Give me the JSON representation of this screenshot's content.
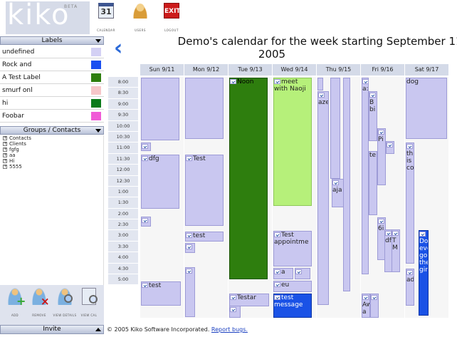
{
  "app": {
    "logo_text": "kiko",
    "logo_badge": "BETA",
    "toolbar": [
      {
        "label": "CALENDAR",
        "glyph": "31",
        "icon": "calendar-icon"
      },
      {
        "label": "USERS",
        "glyph": "",
        "icon": "users-icon"
      },
      {
        "label": "LOGOUT",
        "glyph": "EXIT",
        "icon": "exit-icon"
      }
    ]
  },
  "labels_panel": {
    "header": "Labels",
    "items": [
      {
        "name": "undefined",
        "color": "#d3d0f4"
      },
      {
        "name": "Rock and",
        "color": "#1a4ff0"
      },
      {
        "name": "A Test Label",
        "color": "#2e7e0e"
      },
      {
        "name": "smurf onl",
        "color": "#f6c6c9"
      },
      {
        "name": "hi",
        "color": "#0a7a1a"
      },
      {
        "name": "Foobar",
        "color": "#f05ad7"
      }
    ]
  },
  "groups_panel": {
    "header": "Groups / Contacts",
    "items": [
      "Contacts",
      "Clients",
      "fgfg",
      "aa",
      "Hi",
      "5555"
    ]
  },
  "group_actions": [
    {
      "label": "ADD",
      "icon": "add-user-icon"
    },
    {
      "label": "REMOVE",
      "icon": "remove-user-icon"
    },
    {
      "label": "VIEW DETAILS",
      "icon": "view-details-icon"
    },
    {
      "label": "VIEW CAL",
      "icon": "view-cal-icon"
    }
  ],
  "invite": {
    "label": "Invite"
  },
  "calendar": {
    "title_line1": "Demo's calendar for the week starting September 11,",
    "title_line2": "2005",
    "days": [
      "Sun 9/11",
      "Mon 9/12",
      "Tue 9/13",
      "Wed 9/14",
      "Thu 9/15",
      "Fri 9/16",
      "Sat 9/17"
    ],
    "times": [
      "8:00",
      "8:30",
      "9:00",
      "9:30",
      "10:00",
      "10:30",
      "11:00",
      "11:30",
      "12:00",
      "12:30",
      "1:00",
      "1:30",
      "2:00",
      "2:30",
      "3:00",
      "3:30",
      "4:00",
      "4:30",
      "5:00"
    ],
    "events": [
      {
        "title": "Noon"
      },
      {
        "title": "meet with Naoji"
      },
      {
        "title": "aze"
      },
      {
        "title": "a:"
      },
      {
        "title": "B"
      },
      {
        "title": "bi"
      },
      {
        "title": "dog"
      },
      {
        "title": "dfg"
      },
      {
        "title": "Test"
      },
      {
        "title": "Pi"
      },
      {
        "title": "te"
      },
      {
        "title": "this is coc"
      },
      {
        "title": "aja"
      },
      {
        "title": "test"
      },
      {
        "title": "Test appointme"
      },
      {
        "title": "6i"
      },
      {
        "title": "df"
      },
      {
        "title": "T M"
      },
      {
        "title": "Do eve go the gir"
      },
      {
        "title": "a"
      },
      {
        "title": "test"
      },
      {
        "title": "eu"
      },
      {
        "title": "ads"
      },
      {
        "title": "Testar"
      },
      {
        "title": "test message"
      },
      {
        "title": "Aw a"
      }
    ]
  },
  "footer": {
    "text": "© 2005 Kiko Software Incorporated.",
    "link": "Report bugs."
  }
}
